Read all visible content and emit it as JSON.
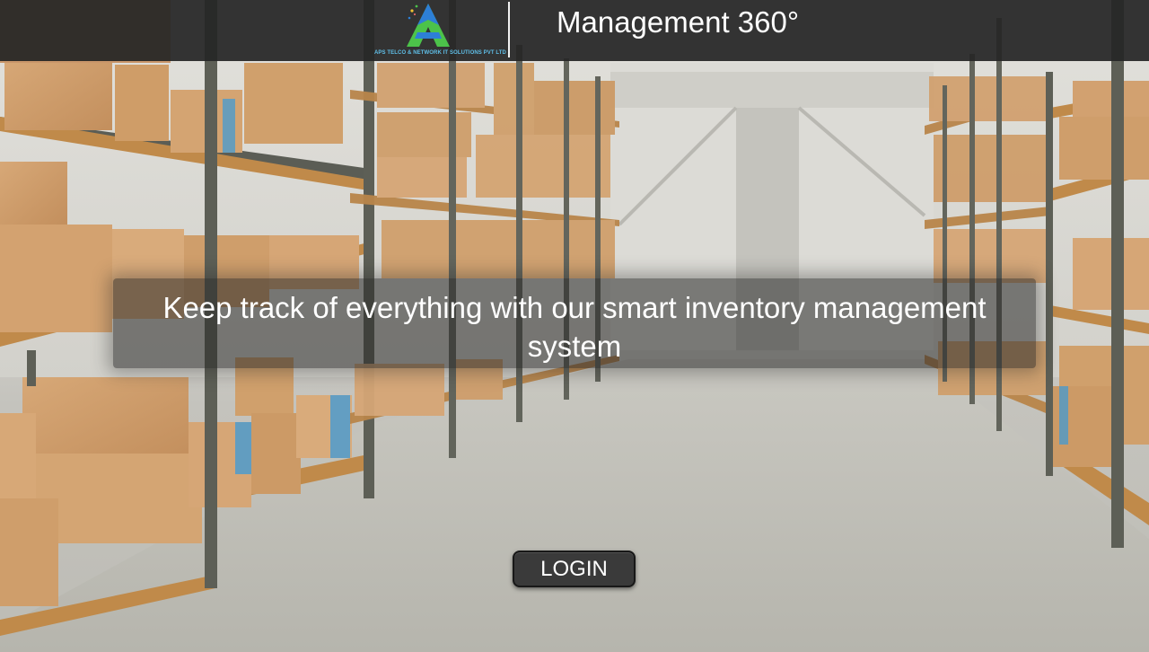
{
  "header": {
    "logo": {
      "icon": "triangle-a-logo-icon",
      "company_name": "APS TELCO & NETWORK IT SOLUTIONS PVT LTD"
    },
    "app_title": "Management 360°"
  },
  "hero": {
    "tagline": "Keep track of everything with our smart inventory management system"
  },
  "actions": {
    "login_label": "LOGIN"
  },
  "colors": {
    "header_bg": "#262626",
    "button_bg": "#3a3a3a",
    "text": "#ffffff",
    "logo_green": "#4cc34a",
    "logo_blue": "#2d7fd6"
  }
}
